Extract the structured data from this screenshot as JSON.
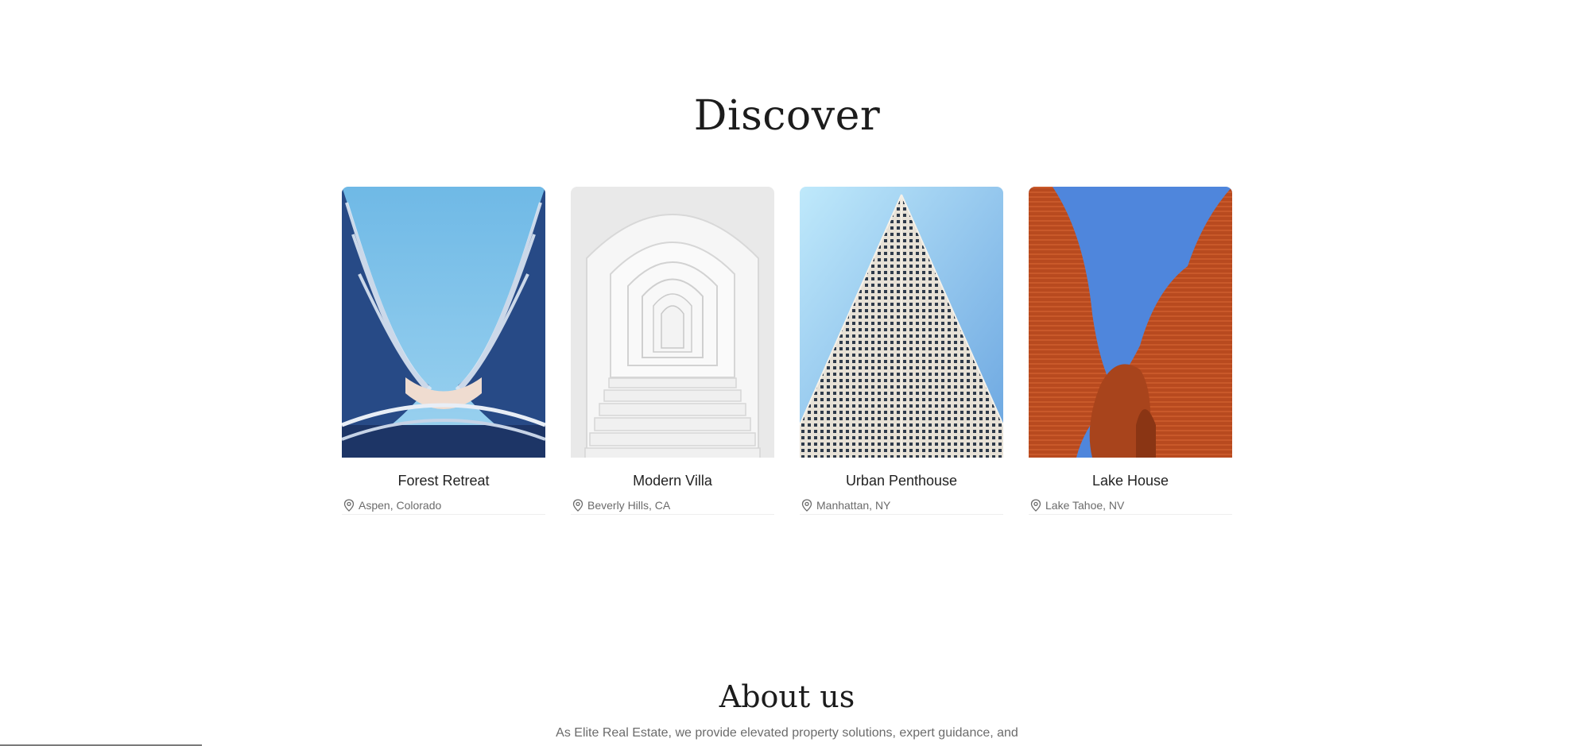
{
  "discover": {
    "title": "Discover",
    "cards": [
      {
        "title": "Forest Retreat",
        "location": "Aspen, Colorado"
      },
      {
        "title": "Modern Villa",
        "location": "Beverly Hills, CA"
      },
      {
        "title": "Urban Penthouse",
        "location": "Manhattan, NY"
      },
      {
        "title": "Lake House",
        "location": "Lake Tahoe, NV"
      }
    ]
  },
  "about": {
    "title": "About us",
    "text": "As Elite Real Estate, we provide elevated property solutions, expert guidance, and"
  },
  "icons": {
    "location": "map-pin-icon"
  },
  "colors": {
    "text_dark": "#1f1f1f",
    "text_muted": "#6b6b6b",
    "background": "#ffffff"
  }
}
